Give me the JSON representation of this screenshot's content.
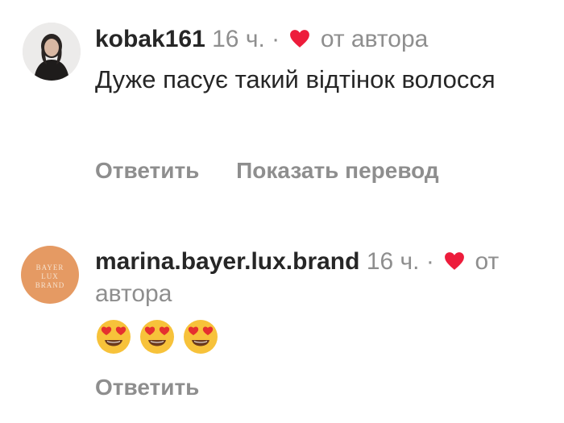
{
  "comments": [
    {
      "username": "kobak161",
      "time": "16 ч.",
      "separator": "·",
      "liked_label": "от автора",
      "text": "Дуже пасує такий відтінок волосся",
      "actions": {
        "reply": "Ответить",
        "translate": "Показать перевод"
      }
    },
    {
      "username": "marina.bayer.lux.brand",
      "time": "16 ч.",
      "separator": "·",
      "liked_label": "от автора",
      "emoji_count": 3,
      "avatar_text": [
        "BAYER",
        "LUX",
        "BRAND"
      ],
      "actions": {
        "reply": "Ответить"
      }
    }
  ],
  "colors": {
    "text": "#262626",
    "muted": "#8e8e8e",
    "heart": "#ed1c3b",
    "brand_avatar": "#e59a63"
  }
}
